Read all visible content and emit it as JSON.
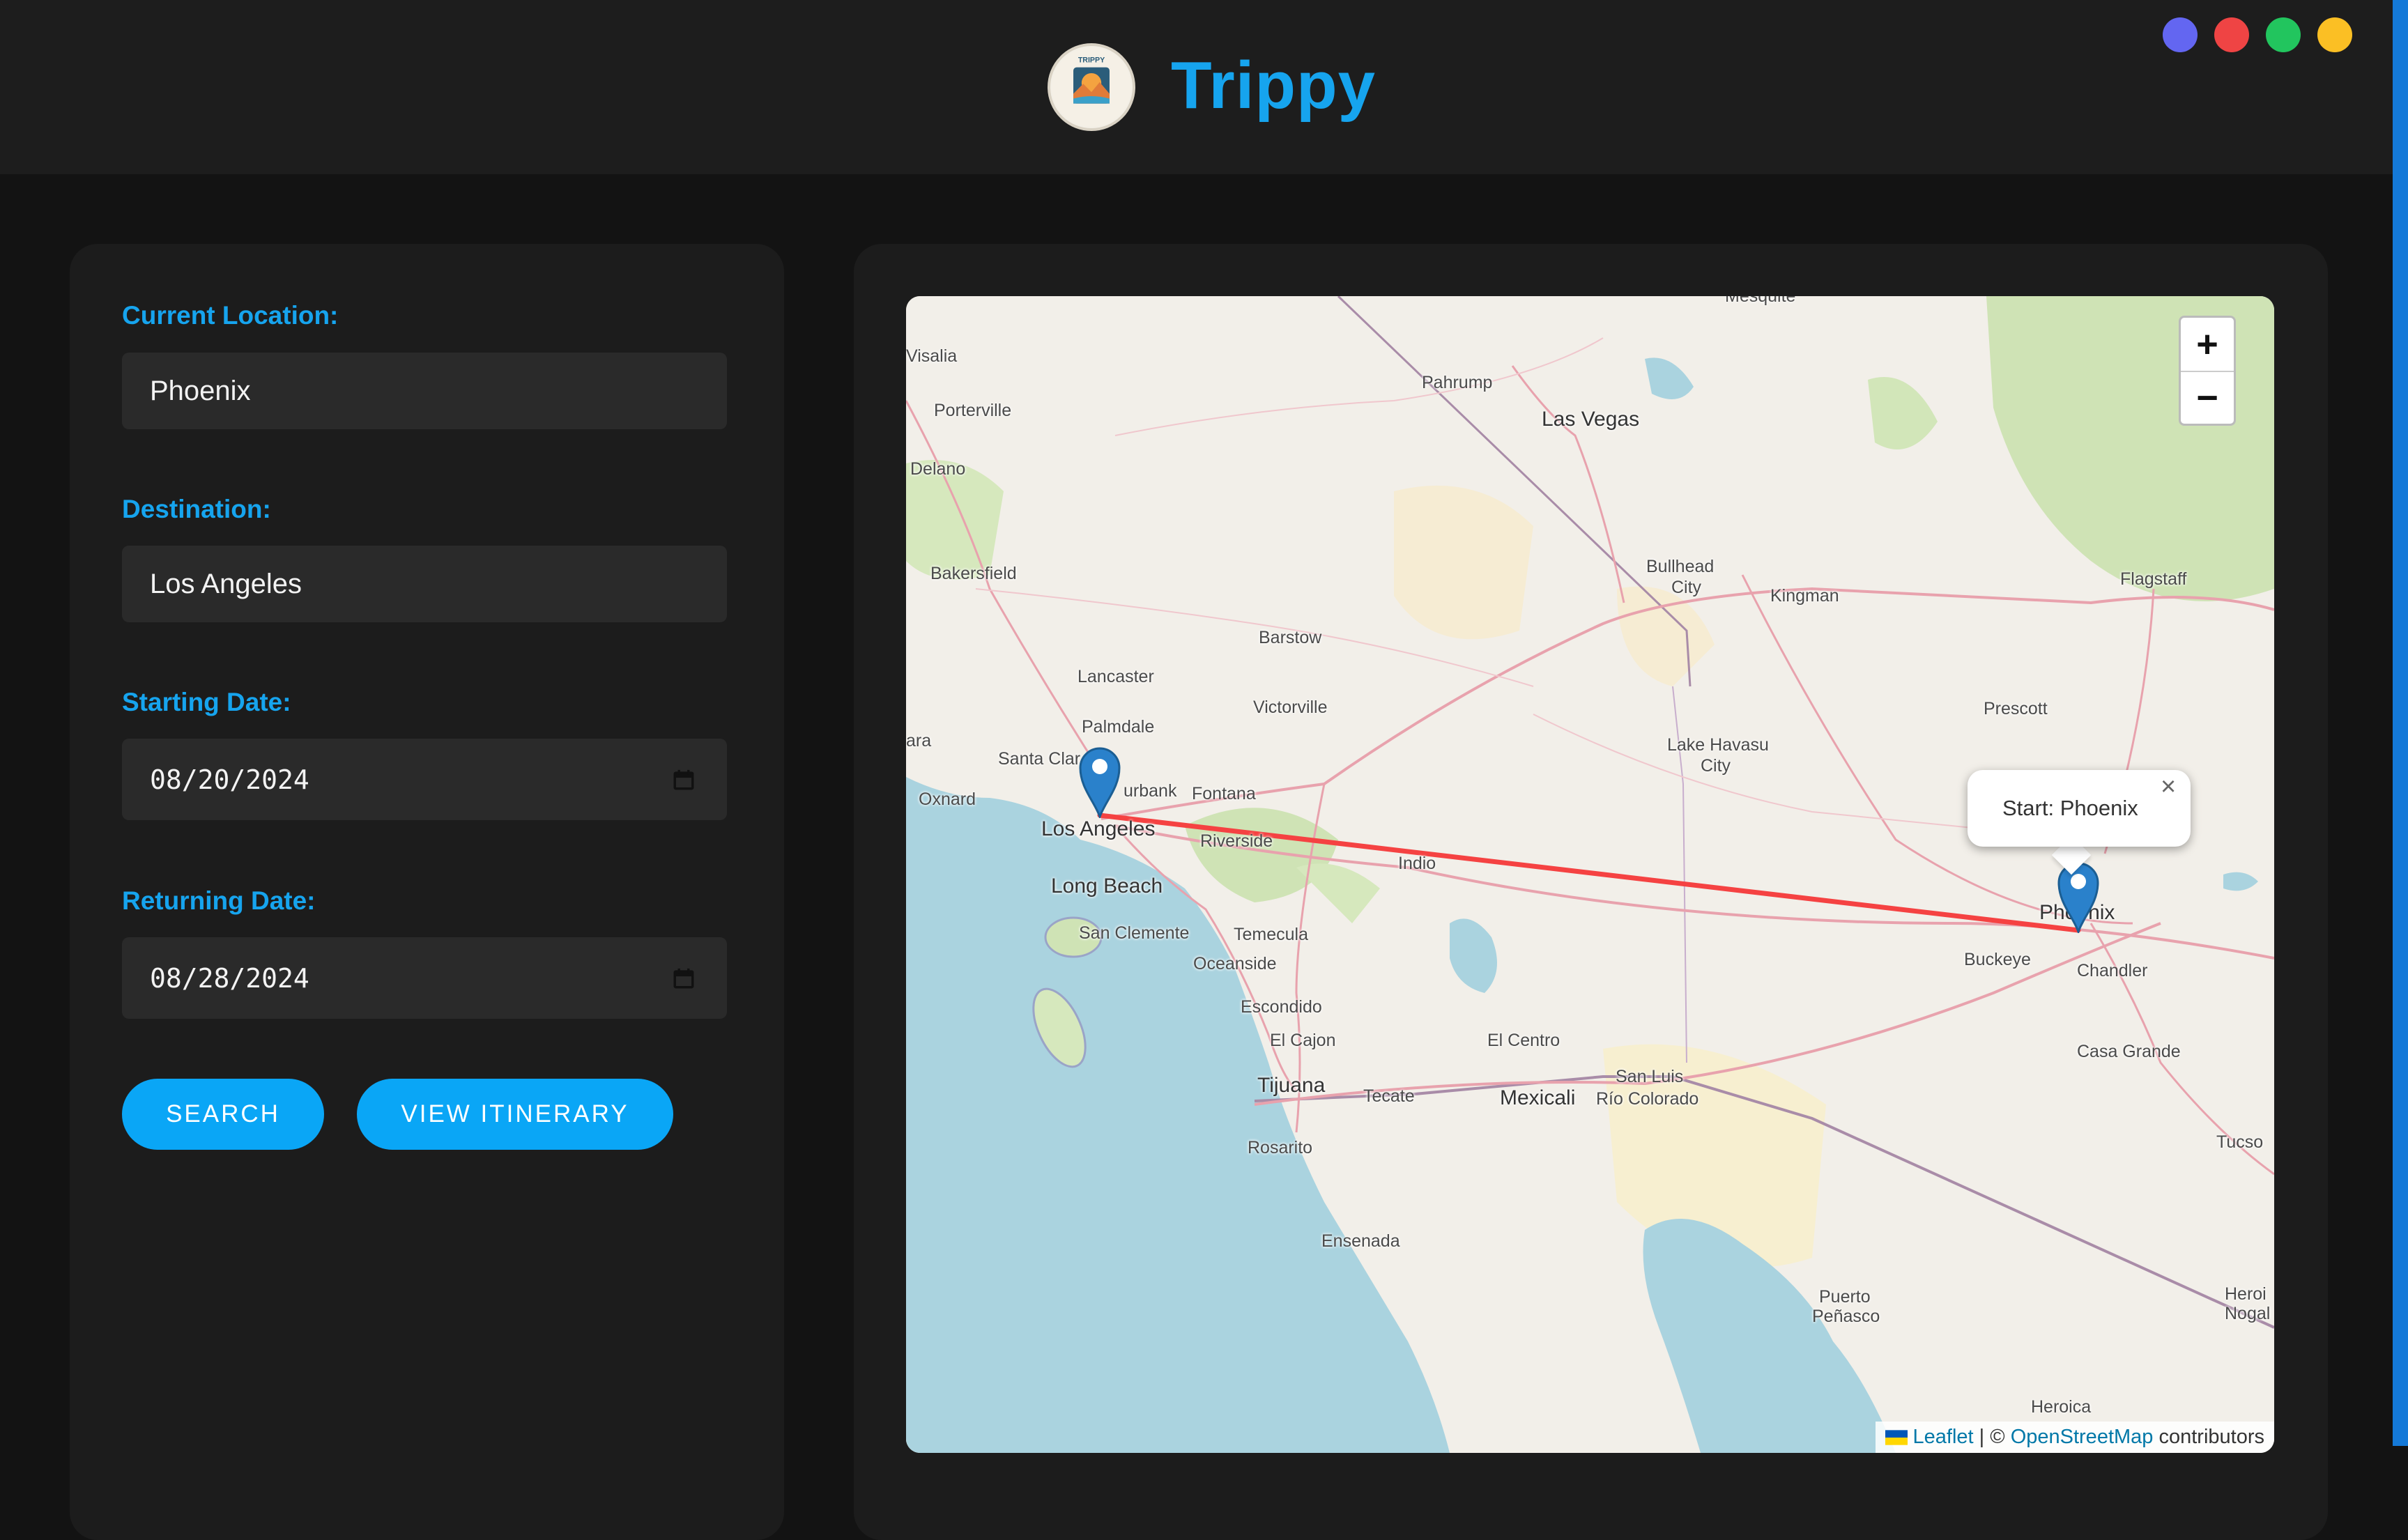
{
  "app": {
    "title": "Trippy",
    "logo_text": "TRIPPY"
  },
  "window_controls": [
    {
      "name": "purple",
      "color": "#6366f1"
    },
    {
      "name": "red",
      "color": "#ef4444"
    },
    {
      "name": "green",
      "color": "#22c55e"
    },
    {
      "name": "yellow",
      "color": "#fbbf24"
    }
  ],
  "form": {
    "current_location": {
      "label": "Current Location:",
      "value": "Phoenix"
    },
    "destination": {
      "label": "Destination:",
      "value": "Los Angeles"
    },
    "starting_date": {
      "label": "Starting Date:",
      "value": "08/20/2024"
    },
    "returning_date": {
      "label": "Returning Date:",
      "value": "08/28/2024"
    },
    "search_label": "SEARCH",
    "itinerary_label": "VIEW ITINERARY"
  },
  "map": {
    "zoom_in": "+",
    "zoom_out": "−",
    "popup_text": "Start: Phoenix",
    "popup_close": "×",
    "attribution": {
      "leaflet": "Leaflet",
      "separator": " | © ",
      "osm": "OpenStreetMap",
      "suffix": " contributors"
    },
    "cities": {
      "visalia": "Visalia",
      "porterville": "Porterville",
      "delano": "Delano",
      "bakersfield": "Bakersfield",
      "mesquite": "Mesquite",
      "pahrump": "Pahrump",
      "las_vegas": "Las Vegas",
      "bullhead": "Bullhead",
      "city": "City",
      "kingman": "Kingman",
      "flagstaff": "Flagstaff",
      "barstow": "Barstow",
      "lancaster": "Lancaster",
      "victorville": "Victorville",
      "palmdale": "Palmdale",
      "santa_clarita": "Santa Clar",
      "oxnard": "Oxnard",
      "burbank": "urbank",
      "fontana": "Fontana",
      "los_angeles": "Los Angeles",
      "riverside": "Riverside",
      "long_beach": "Long Beach",
      "san_clemente": "San Clemente",
      "temecula": "Temecula",
      "oceanside": "Oceanside",
      "escondido": "Escondido",
      "el_cajon": "El Cajon",
      "tijuana": "Tijuana",
      "tecate": "Tecate",
      "rosarito": "Rosarito",
      "ensenada": "Ensenada",
      "indio": "Indio",
      "lake_havasu": "Lake Havasu",
      "lake_havasu_city": "City",
      "prescott": "Prescott",
      "phoenix": "Phoenix",
      "buckeye": "Buckeye",
      "chandler": "Chandler",
      "casa_grande": "Casa Grande",
      "el_centro": "El Centro",
      "mexicali": "Mexicali",
      "san_luis": "San Luis",
      "rio_colorado": "Río Colorado",
      "tucson": "Tucso",
      "puerto": "Puerto",
      "penasco": "Peñasco",
      "heroica": "Heroica",
      "heroica_nogales": "Heroi",
      "nogales": "Nogal",
      "ara": "ara"
    }
  }
}
